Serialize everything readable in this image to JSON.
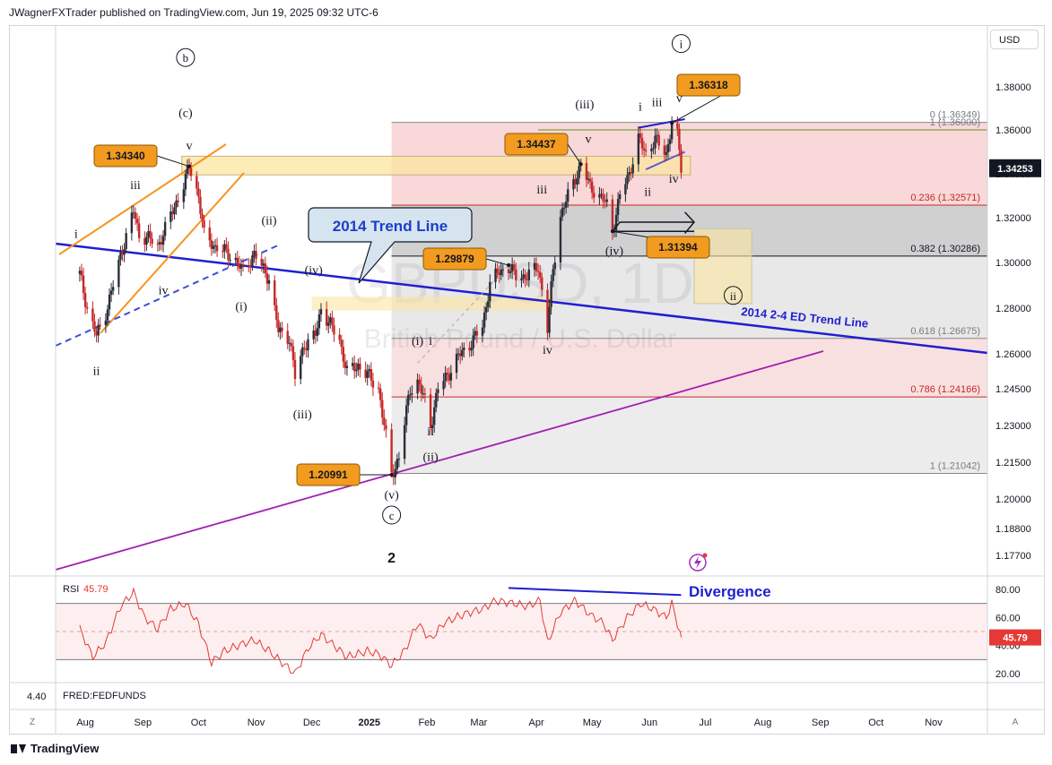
{
  "header": {
    "publisher": "JWagnerFXTrader published on TradingView.com, Jun 19, 2025 09:32 UTC-6"
  },
  "toolbar": {
    "currency_label": "USD",
    "z_label": "Z",
    "a_label": "A"
  },
  "footer": {
    "brand": "TradingView"
  },
  "watermark": {
    "symbol": "GBPUSD, 1D",
    "name": "British Pound / U.S. Dollar"
  },
  "colors": {
    "up": "#2a2e39",
    "down": "#c62828",
    "trend_blue": "#1f1fd1",
    "channel_orange": "#f7941d",
    "support_purple": "#a020b0",
    "fib_red": "#c62828",
    "label_orange": "#f29b1f",
    "rsi": "#e53935"
  },
  "chart_data": {
    "type": "candlestick",
    "symbol": "GBPUSD",
    "timeframe": "1D",
    "price_axis": {
      "ticks": [
        "1.38000",
        "1.36000",
        "1.34000",
        "1.32000",
        "1.30000",
        "1.28000",
        "1.26000",
        "1.24500",
        "1.23000",
        "1.21500",
        "1.20000",
        "1.18800",
        "1.17700"
      ],
      "current_price": "1.34253"
    },
    "time_axis": {
      "ticks": [
        "Aug",
        "Sep",
        "Oct",
        "Nov",
        "Dec",
        "2025",
        "Feb",
        "Mar",
        "Apr",
        "May",
        "Jun",
        "Jul",
        "Aug",
        "Sep",
        "Oct",
        "Nov"
      ]
    },
    "close_path": [
      [
        "2024-07-29",
        1.295
      ],
      [
        "2024-08-02",
        1.28
      ],
      [
        "2024-08-07",
        1.268
      ],
      [
        "2024-08-12",
        1.278
      ],
      [
        "2024-08-16",
        1.29
      ],
      [
        "2024-08-21",
        1.306
      ],
      [
        "2024-08-27",
        1.323
      ],
      [
        "2024-08-30",
        1.312
      ],
      [
        "2024-09-04",
        1.311
      ],
      [
        "2024-09-09",
        1.307
      ],
      [
        "2024-09-12",
        1.313
      ],
      [
        "2024-09-18",
        1.325
      ],
      [
        "2024-09-23",
        1.335
      ],
      [
        "2024-09-26",
        1.3434
      ],
      [
        "2024-10-01",
        1.33
      ],
      [
        "2024-10-04",
        1.312
      ],
      [
        "2024-10-10",
        1.307
      ],
      [
        "2024-10-15",
        1.305
      ],
      [
        "2024-10-21",
        1.301
      ],
      [
        "2024-10-25",
        1.296
      ],
      [
        "2024-10-31",
        1.304
      ],
      [
        "2024-11-04",
        1.298
      ],
      [
        "2024-11-08",
        1.293
      ],
      [
        "2024-11-13",
        1.27
      ],
      [
        "2024-11-19",
        1.267
      ],
      [
        "2024-11-22",
        1.25
      ],
      [
        "2024-11-27",
        1.264
      ],
      [
        "2024-12-03",
        1.268
      ],
      [
        "2024-12-06",
        1.28
      ],
      [
        "2024-12-10",
        1.274
      ],
      [
        "2024-12-16",
        1.266
      ],
      [
        "2024-12-20",
        1.252
      ],
      [
        "2024-12-26",
        1.255
      ],
      [
        "2024-12-31",
        1.251
      ],
      [
        "2025-01-06",
        1.245
      ],
      [
        "2025-01-10",
        1.225
      ],
      [
        "2025-01-13",
        1.2099
      ],
      [
        "2025-01-17",
        1.217
      ],
      [
        "2025-01-23",
        1.245
      ],
      [
        "2025-01-27",
        1.248
      ],
      [
        "2025-01-31",
        1.24
      ],
      [
        "2025-02-03",
        1.23
      ],
      [
        "2025-02-07",
        1.245
      ],
      [
        "2025-02-13",
        1.252
      ],
      [
        "2025-02-18",
        1.259
      ],
      [
        "2025-02-24",
        1.264
      ],
      [
        "2025-03-03",
        1.272
      ],
      [
        "2025-03-07",
        1.291
      ],
      [
        "2025-03-12",
        1.296
      ],
      [
        "2025-03-17",
        1.298
      ],
      [
        "2025-03-21",
        1.294
      ],
      [
        "2025-03-27",
        1.294
      ],
      [
        "2025-04-02",
        1.298
      ],
      [
        "2025-04-04",
        1.288
      ],
      [
        "2025-04-07",
        1.271
      ],
      [
        "2025-04-10",
        1.297
      ],
      [
        "2025-04-14",
        1.321
      ],
      [
        "2025-04-18",
        1.33
      ],
      [
        "2025-04-22",
        1.338
      ],
      [
        "2025-04-25",
        1.3444
      ],
      [
        "2025-04-30",
        1.334
      ],
      [
        "2025-05-05",
        1.33
      ],
      [
        "2025-05-09",
        1.326
      ],
      [
        "2025-05-12",
        1.3139
      ],
      [
        "2025-05-16",
        1.33
      ],
      [
        "2025-05-21",
        1.34
      ],
      [
        "2025-05-26",
        1.356
      ],
      [
        "2025-05-30",
        1.349
      ],
      [
        "2025-06-04",
        1.356
      ],
      [
        "2025-06-06",
        1.353
      ],
      [
        "2025-06-10",
        1.349
      ],
      [
        "2025-06-13",
        1.3632
      ],
      [
        "2025-06-16",
        1.357
      ],
      [
        "2025-06-18",
        1.3425
      ]
    ],
    "price_labels": [
      {
        "text": "1.34340",
        "date": "2024-09-26",
        "price": 1.3434
      },
      {
        "text": "1.34437",
        "date": "2025-04-25",
        "price": 1.3444
      },
      {
        "text": "1.36318",
        "date": "2025-06-13",
        "price": 1.3632
      },
      {
        "text": "1.29879",
        "date": "2025-03-17",
        "price": 1.2988
      },
      {
        "text": "1.31394",
        "date": "2025-05-12",
        "price": 1.3139
      },
      {
        "text": "1.20991",
        "date": "2025-01-13",
        "price": 1.2099
      }
    ],
    "fibonacci": [
      {
        "level": "0",
        "value": "1.36349",
        "price": 1.36349
      },
      {
        "level": "1",
        "value": "1.36000",
        "price": 1.36
      },
      {
        "level": "0.236",
        "value": "1.32571",
        "price": 1.32571
      },
      {
        "level": "0.382",
        "value": "1.30286",
        "price": 1.30286
      },
      {
        "level": "0.618",
        "value": "1.26675",
        "price": 1.26675
      },
      {
        "level": "0.786",
        "value": "1.24166",
        "price": 1.24166
      },
      {
        "level": "1",
        "value": "1.21042",
        "price": 1.21042
      }
    ],
    "wave_labels": [
      {
        "text": "i",
        "date": "2024-07-27",
        "price": 1.311
      },
      {
        "text": "ii",
        "date": "2024-08-07",
        "price": 1.251
      },
      {
        "text": "iii",
        "date": "2024-08-28",
        "price": 1.333
      },
      {
        "text": "iv",
        "date": "2024-09-12",
        "price": 1.286
      },
      {
        "text": "v",
        "date": "2024-09-26",
        "price": 1.351
      },
      {
        "text": "(c)",
        "date": "2024-09-24",
        "price": 1.366
      },
      {
        "text": "b",
        "date": "2024-09-24",
        "price": 1.392,
        "circled": true
      },
      {
        "text": "(ii)",
        "date": "2024-11-08",
        "price": 1.317
      },
      {
        "text": "(i)",
        "date": "2024-10-24",
        "price": 1.279
      },
      {
        "text": "(iv)",
        "date": "2024-12-02",
        "price": 1.295
      },
      {
        "text": "(iii)",
        "date": "2024-11-26",
        "price": 1.233
      },
      {
        "text": "(v)",
        "date": "2025-01-13",
        "price": 1.2
      },
      {
        "text": "c",
        "date": "2025-01-13",
        "price": 1.192,
        "circled": true
      },
      {
        "text": "2",
        "date": "2025-01-13",
        "price": 1.174
      },
      {
        "text": "(i)",
        "date": "2025-01-27",
        "price": 1.264
      },
      {
        "text": "i",
        "date": "2025-02-03",
        "price": 1.264
      },
      {
        "text": "ii",
        "date": "2025-02-03",
        "price": 1.226
      },
      {
        "text": "(ii)",
        "date": "2025-02-03",
        "price": 1.2155
      },
      {
        "text": "iii",
        "date": "2025-04-04",
        "price": 1.331
      },
      {
        "text": "iv",
        "date": "2025-04-07",
        "price": 1.26
      },
      {
        "text": "v",
        "date": "2025-04-29",
        "price": 1.354
      },
      {
        "text": "(iii)",
        "date": "2025-04-27",
        "price": 1.37
      },
      {
        "text": "(iv)",
        "date": "2025-05-13",
        "price": 1.3035
      },
      {
        "text": "i",
        "date": "2025-05-27",
        "price": 1.369
      },
      {
        "text": "ii",
        "date": "2025-05-31",
        "price": 1.33
      },
      {
        "text": "iii",
        "date": "2025-06-05",
        "price": 1.371
      },
      {
        "text": "iv",
        "date": "2025-06-14",
        "price": 1.336
      },
      {
        "text": "v",
        "date": "2025-06-17",
        "price": 1.373
      },
      {
        "text": "i",
        "date": "2025-06-18",
        "price": 1.3985,
        "circled": true
      },
      {
        "text": "ii",
        "date": "2025-07-16",
        "price": 1.284,
        "circled": true
      }
    ],
    "annotations": {
      "trend_callout": "2014 Trend Line",
      "ed_trend_label": "2014 2-4 ED Trend Line",
      "divergence_label": "Divergence"
    },
    "rsi": {
      "label": "RSI",
      "value": "45.79",
      "ticks": [
        "80.00",
        "60.00",
        "40.00",
        "20.00"
      ],
      "bands": [
        70,
        30
      ],
      "path": [
        [
          "2024-07-29",
          52
        ],
        [
          "2024-08-05",
          32
        ],
        [
          "2024-08-12",
          42
        ],
        [
          "2024-08-20",
          68
        ],
        [
          "2024-08-27",
          78
        ],
        [
          "2024-09-02",
          60
        ],
        [
          "2024-09-09",
          52
        ],
        [
          "2024-09-16",
          66
        ],
        [
          "2024-09-24",
          70
        ],
        [
          "2024-10-01",
          55
        ],
        [
          "2024-10-08",
          28
        ],
        [
          "2024-10-15",
          36
        ],
        [
          "2024-10-22",
          40
        ],
        [
          "2024-10-31",
          44
        ],
        [
          "2024-11-08",
          36
        ],
        [
          "2024-11-15",
          28
        ],
        [
          "2024-11-22",
          20
        ],
        [
          "2024-11-29",
          38
        ],
        [
          "2024-12-06",
          48
        ],
        [
          "2024-12-13",
          40
        ],
        [
          "2024-12-20",
          32
        ],
        [
          "2024-12-31",
          36
        ],
        [
          "2025-01-06",
          34
        ],
        [
          "2025-01-13",
          26
        ],
        [
          "2025-01-20",
          36
        ],
        [
          "2025-01-27",
          56
        ],
        [
          "2025-02-03",
          44
        ],
        [
          "2025-02-10",
          56
        ],
        [
          "2025-02-20",
          62
        ],
        [
          "2025-03-03",
          66
        ],
        [
          "2025-03-10",
          72
        ],
        [
          "2025-03-20",
          70
        ],
        [
          "2025-03-27",
          68
        ],
        [
          "2025-04-03",
          72
        ],
        [
          "2025-04-07",
          42
        ],
        [
          "2025-04-14",
          64
        ],
        [
          "2025-04-22",
          72
        ],
        [
          "2025-04-30",
          62
        ],
        [
          "2025-05-07",
          56
        ],
        [
          "2025-05-12",
          44
        ],
        [
          "2025-05-20",
          60
        ],
        [
          "2025-05-27",
          70
        ],
        [
          "2025-06-03",
          66
        ],
        [
          "2025-06-10",
          60
        ],
        [
          "2025-06-13",
          70
        ],
        [
          "2025-06-18",
          45.79
        ]
      ]
    },
    "fedfunds": {
      "label": "FRED:FEDFUNDS",
      "value": "4.40"
    }
  }
}
